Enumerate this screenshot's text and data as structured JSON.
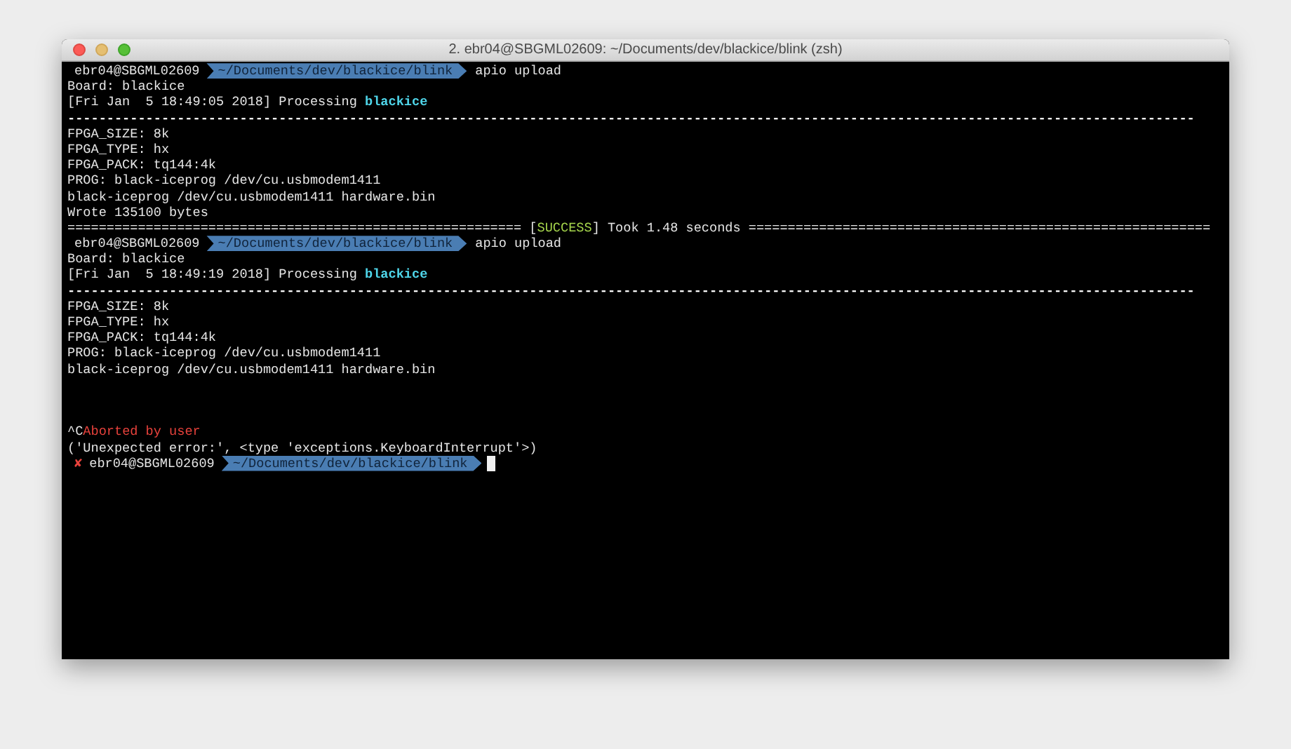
{
  "window": {
    "title": "2. ebr04@SBGML02609: ~/Documents/dev/blackice/blink (zsh)"
  },
  "terminal": {
    "lines": [
      {
        "kind": "prompt",
        "user": "ebr04@SBGML02609",
        "path": "~/Documents/dev/blackice/blink",
        "command": "apio upload"
      },
      {
        "kind": "output",
        "segments": [
          {
            "text": "Board: blackice",
            "color": "#e6e6e6"
          }
        ]
      },
      {
        "kind": "output",
        "segments": [
          {
            "text": "[Fri Jan  5 18:49:05 2018] Processing ",
            "color": "#e6e6e6"
          },
          {
            "text": "blackice",
            "color": "#4fd6ea",
            "bold": true
          }
        ]
      },
      {
        "kind": "output",
        "segments": [
          {
            "text": "------------------------------------------------------------------------------------------------------------------------------------------------",
            "color": "#ffffff",
            "bold": true
          }
        ]
      },
      {
        "kind": "output",
        "segments": [
          {
            "text": "FPGA_SIZE: 8k",
            "color": "#e6e6e6"
          }
        ]
      },
      {
        "kind": "output",
        "segments": [
          {
            "text": "FPGA_TYPE: hx",
            "color": "#e6e6e6"
          }
        ]
      },
      {
        "kind": "output",
        "segments": [
          {
            "text": "FPGA_PACK: tq144:4k",
            "color": "#e6e6e6"
          }
        ]
      },
      {
        "kind": "output",
        "segments": [
          {
            "text": "PROG: black-iceprog /dev/cu.usbmodem1411",
            "color": "#e6e6e6"
          }
        ]
      },
      {
        "kind": "output",
        "segments": [
          {
            "text": "black-iceprog /dev/cu.usbmodem1411 hardware.bin",
            "color": "#e6e6e6"
          }
        ]
      },
      {
        "kind": "output",
        "segments": [
          {
            "text": "Wrote 135100 bytes",
            "color": "#e6e6e6"
          }
        ]
      },
      {
        "kind": "output",
        "segments": [
          {
            "text": "========================================================== [",
            "color": "#e6e6e6"
          },
          {
            "text": "SUCCESS",
            "color": "#a6d64c"
          },
          {
            "text": "] Took 1.48 seconds ===========================================================",
            "color": "#e6e6e6"
          }
        ]
      },
      {
        "kind": "prompt",
        "user": "ebr04@SBGML02609",
        "path": "~/Documents/dev/blackice/blink",
        "command": "apio upload"
      },
      {
        "kind": "output",
        "segments": [
          {
            "text": "Board: blackice",
            "color": "#e6e6e6"
          }
        ]
      },
      {
        "kind": "output",
        "segments": [
          {
            "text": "[Fri Jan  5 18:49:19 2018] Processing ",
            "color": "#e6e6e6"
          },
          {
            "text": "blackice",
            "color": "#4fd6ea",
            "bold": true
          }
        ]
      },
      {
        "kind": "output",
        "segments": [
          {
            "text": "------------------------------------------------------------------------------------------------------------------------------------------------",
            "color": "#ffffff",
            "bold": true
          }
        ]
      },
      {
        "kind": "output",
        "segments": [
          {
            "text": "FPGA_SIZE: 8k",
            "color": "#e6e6e6"
          }
        ]
      },
      {
        "kind": "output",
        "segments": [
          {
            "text": "FPGA_TYPE: hx",
            "color": "#e6e6e6"
          }
        ]
      },
      {
        "kind": "output",
        "segments": [
          {
            "text": "FPGA_PACK: tq144:4k",
            "color": "#e6e6e6"
          }
        ]
      },
      {
        "kind": "output",
        "segments": [
          {
            "text": "PROG: black-iceprog /dev/cu.usbmodem1411",
            "color": "#e6e6e6"
          }
        ]
      },
      {
        "kind": "output",
        "segments": [
          {
            "text": "black-iceprog /dev/cu.usbmodem1411 hardware.bin",
            "color": "#e6e6e6"
          }
        ]
      },
      {
        "kind": "blank"
      },
      {
        "kind": "blank"
      },
      {
        "kind": "blank"
      },
      {
        "kind": "output",
        "segments": [
          {
            "text": "^C",
            "color": "#e6e6e6"
          },
          {
            "text": "Aborted by user",
            "color": "#e8423c"
          }
        ]
      },
      {
        "kind": "output",
        "segments": [
          {
            "text": "('Unexpected error:', <type 'exceptions.KeyboardInterrupt'>)",
            "color": "#e6e6e6"
          }
        ]
      },
      {
        "kind": "prompt",
        "status_mark": "✘",
        "user": "ebr04@SBGML02609",
        "path": "~/Documents/dev/blackice/blink",
        "cursor": true
      }
    ]
  }
}
